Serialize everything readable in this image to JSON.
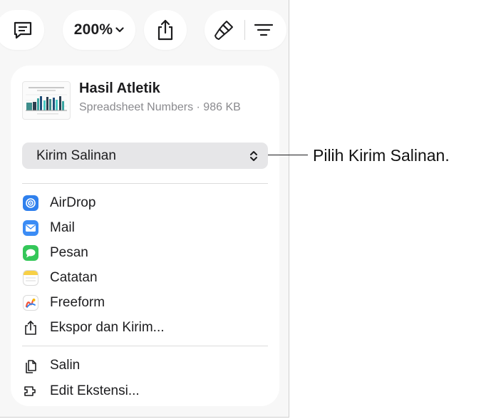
{
  "toolbar": {
    "zoom_label": "200%"
  },
  "file": {
    "title": "Hasil Atletik",
    "subtitle": "Spreadsheet Numbers · 986 KB"
  },
  "send_select": {
    "value": "Kirim Salinan"
  },
  "share_targets": [
    {
      "label": "AirDrop",
      "icon": "airdrop-icon"
    },
    {
      "label": "Mail",
      "icon": "mail-icon"
    },
    {
      "label": "Pesan",
      "icon": "messages-icon"
    },
    {
      "label": "Catatan",
      "icon": "notes-icon"
    },
    {
      "label": "Freeform",
      "icon": "freeform-icon"
    },
    {
      "label": "Ekspor dan Kirim...",
      "icon": "export-icon"
    }
  ],
  "actions": [
    {
      "label": "Salin",
      "icon": "copy-icon"
    },
    {
      "label": "Edit Ekstensi...",
      "icon": "extensions-icon"
    }
  ],
  "callout": {
    "text": "Pilih Kirim Salinan."
  },
  "colors": {
    "panel_background": "#f7f7f7",
    "airdrop": "#2f80ed",
    "mail": "#3b8cf5",
    "messages": "#34c759",
    "notes": "#f7d046"
  }
}
